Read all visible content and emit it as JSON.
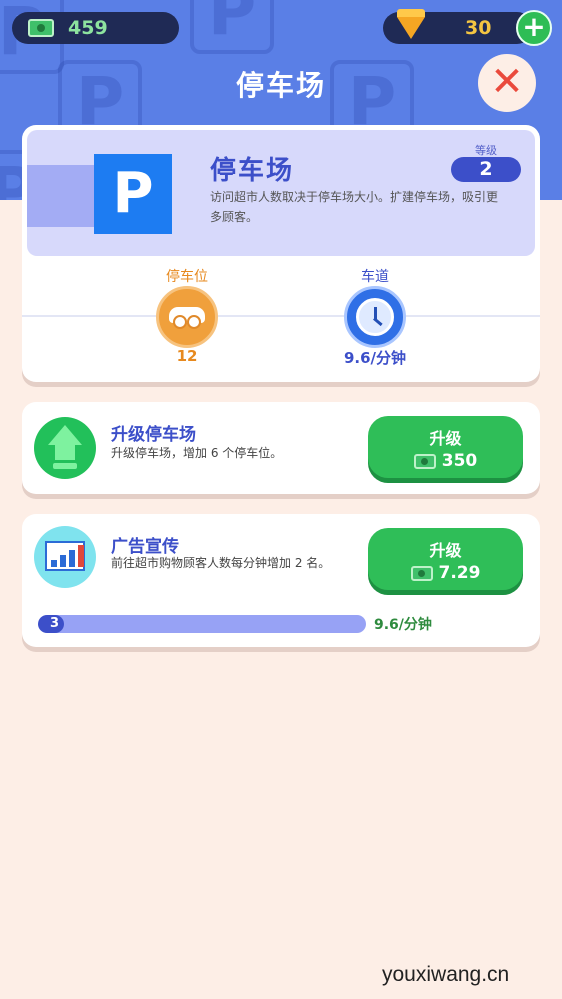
{
  "currency": {
    "cash": "459",
    "gems": "30",
    "cash_icon": "cash-icon",
    "gem_icon": "diamond-icon"
  },
  "header": {
    "title": "停车场"
  },
  "facility": {
    "sign_letter": "P",
    "name": "停车场",
    "description": "访问超市人数取决于停车场大小。扩建停车场，吸引更多顾客。",
    "level_label": "等级",
    "level": "2",
    "stats": [
      {
        "label": "停车位",
        "value": "12",
        "icon": "car-icon",
        "color": "#e7891e"
      },
      {
        "label": "车道",
        "value": "9.6/分钟",
        "icon": "clock-icon",
        "color": "#3c4fc9"
      }
    ]
  },
  "upgrades": [
    {
      "name": "升级停车场",
      "description": "升级停车场，增加 6 个停车位。",
      "icon": "upgrade-arrow-icon",
      "button_label": "升级",
      "price": "350"
    },
    {
      "name": "广告宣传",
      "description": "前往超市购物顾客人数每分钟增加 2 名。",
      "icon": "chart-board-icon",
      "button_label": "升级",
      "price": "7.29",
      "progress_level": "3",
      "progress_fraction": 0.08,
      "rate": "9.6/分钟"
    }
  ],
  "colors": {
    "header_blue": "#5a7fe6",
    "accent_blue": "#3c4fc9",
    "button_green": "#2fbe58",
    "close_red": "#ea4a3c"
  },
  "watermark": "youxiwang.cn"
}
